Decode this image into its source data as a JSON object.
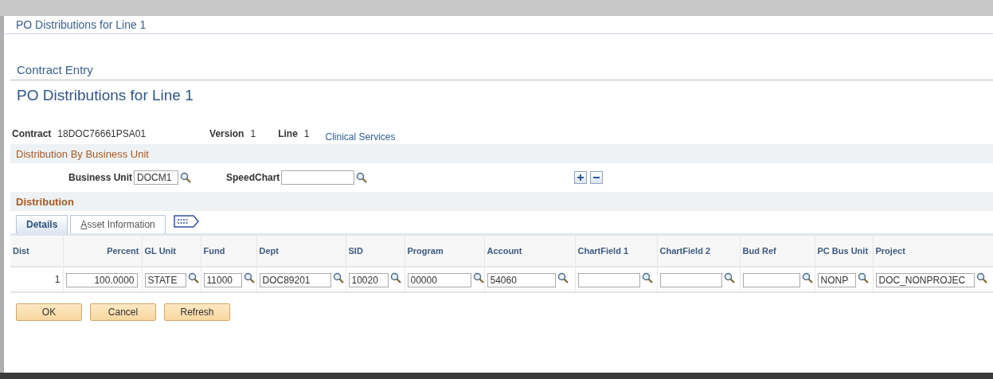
{
  "dialog": {
    "title": "PO Distributions for Line 1"
  },
  "breadcrumb": "Contract Entry",
  "page_title": "PO Distributions for Line 1",
  "summary": [
    {
      "label": "Contract",
      "value": "18DOC76661PSA01"
    },
    {
      "label": "Version",
      "value": "1"
    },
    {
      "label": "Line",
      "value": "1"
    }
  ],
  "description_link": "Clinical Services",
  "business_unit_section": {
    "title": "Distribution By Business Unit",
    "fields": [
      {
        "label": "Business Unit",
        "value": "DOCM1"
      },
      {
        "label": "SpeedChart"
      }
    ]
  },
  "distribution": {
    "title": "Distribution",
    "tabs": [
      {
        "label": "Details",
        "selected": true
      },
      {
        "label": "Asset Information",
        "selected": false
      }
    ],
    "columns": [
      "Dist",
      "Percent",
      "GL Unit",
      "Fund",
      "Dept",
      "SID",
      "Program",
      "Account",
      "ChartField 1",
      "ChartField 2",
      "Bud Ref",
      "PC Bus Unit",
      "Project"
    ],
    "rows": [
      {
        "cells": [
          {
            "kind": "text",
            "value": "1"
          },
          {
            "kind": "number",
            "value": "100.0000"
          },
          {
            "kind": "lookup",
            "value": "STATE"
          },
          {
            "kind": "lookup",
            "value": "11000"
          },
          {
            "kind": "lookup",
            "value": "DOC89201"
          },
          {
            "kind": "lookup",
            "value": "10020"
          },
          {
            "kind": "lookup",
            "value": "00000"
          },
          {
            "kind": "lookup",
            "value": "54060"
          },
          {
            "kind": "lookup"
          },
          {
            "kind": "lookup"
          },
          {
            "kind": "lookup"
          },
          {
            "kind": "lookup",
            "value": "NONP"
          },
          {
            "kind": "lookup",
            "value": "DOC_NONPROJEC"
          }
        ]
      }
    ]
  },
  "buttons": [
    "OK",
    "Cancel",
    "Refresh"
  ]
}
